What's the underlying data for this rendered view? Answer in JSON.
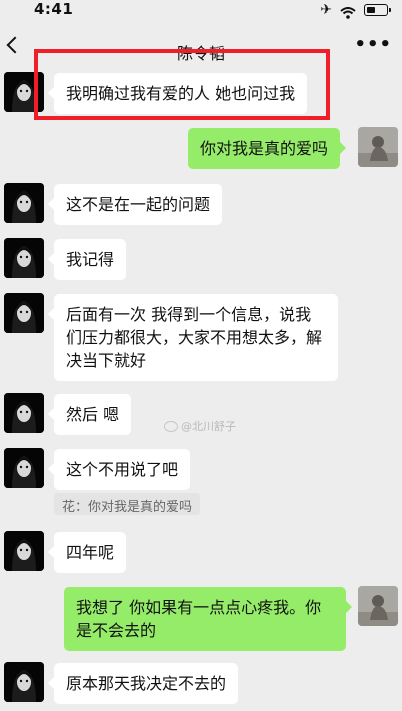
{
  "status_bar": {
    "time": "4:41",
    "icons": [
      "airplane-icon",
      "wifi-icon",
      "battery-icon"
    ]
  },
  "nav": {
    "title": "陈令韬",
    "back_icon": "chevron-left-icon",
    "more_label": "•••"
  },
  "messages": [
    {
      "side": "in",
      "text": "我明确过我有爱的人 她也问过我"
    },
    {
      "side": "out",
      "text": "你对我是真的爱吗"
    },
    {
      "side": "in",
      "text": "这不是在一起的问题"
    },
    {
      "side": "in",
      "text": "我记得"
    },
    {
      "side": "in",
      "text": "后面有一次 我得到一个信息，说我们压力都很大，大家不用想太多，解决当下就好"
    },
    {
      "side": "in",
      "text": "然后 嗯"
    },
    {
      "side": "in",
      "text": "这个不用说了吧",
      "quote": "花：你对我是真的爱吗"
    },
    {
      "side": "in",
      "text": "四年呢"
    },
    {
      "side": "out",
      "text": "我想了 你如果有一点点心疼我。你是不会去的"
    },
    {
      "side": "in",
      "text": "原本那天我决定不去的"
    }
  ],
  "watermark": {
    "text": "@北川舒子"
  },
  "colors": {
    "background": "#ededed",
    "incoming_bubble": "#ffffff",
    "outgoing_bubble": "#95ec69",
    "highlight_border": "#f01e28"
  }
}
